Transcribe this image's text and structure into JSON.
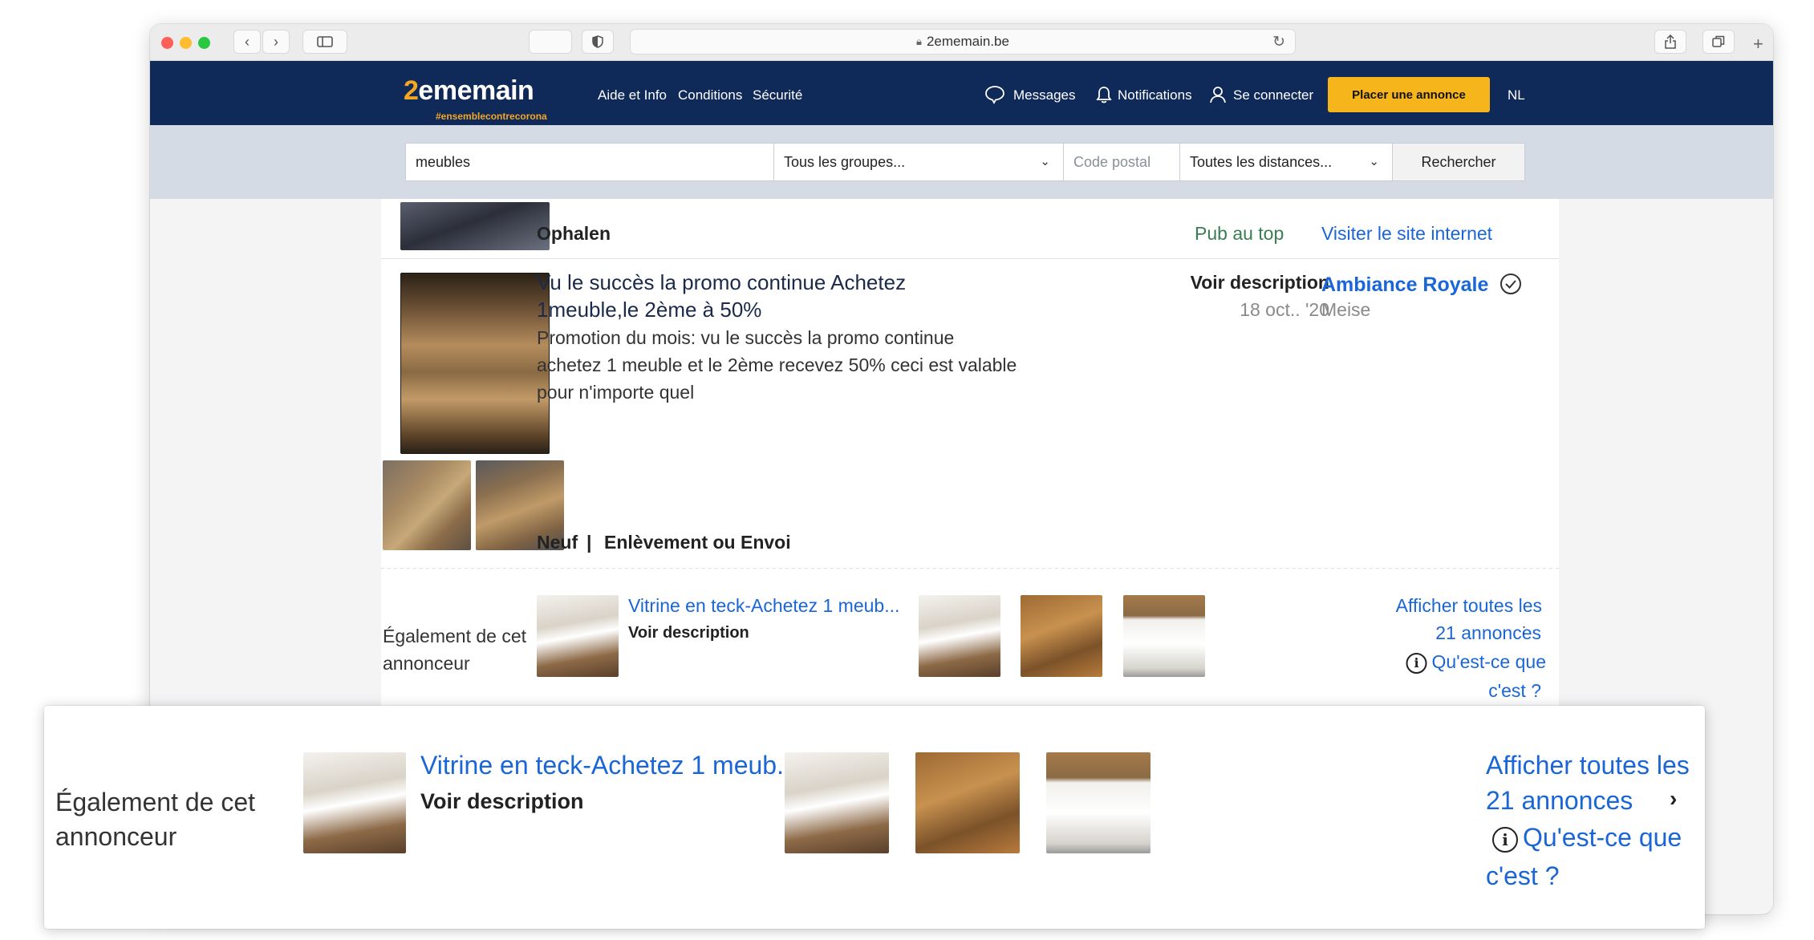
{
  "browser": {
    "url": "2ememain.be"
  },
  "header": {
    "logo": "2ememain",
    "logo_tagline": "#ensemblecontrecorona",
    "nav": [
      "Aide et Info",
      "Conditions",
      "Sécurité"
    ],
    "messages_label": "Messages",
    "notifications_label": "Notifications",
    "login_label": "Se connecter",
    "post_ad_label": "Placer une annonce",
    "language_label": "NL",
    "brand_color": "#0f2a58",
    "accent_color": "#f5b51b"
  },
  "search": {
    "query": "meubles",
    "group_select": "Tous les groupes...",
    "postal_placeholder": "Code postal",
    "distance_select": "Toutes les distances...",
    "submit_label": "Rechercher"
  },
  "prev_listing": {
    "delivery": "Ophalen",
    "top_ad_label": "Pub au top",
    "visit_site_label": "Visiter le site internet"
  },
  "listing": {
    "title_line1": "Vu le succès la promo continue Achetez",
    "title_line2": "1meuble,le 2ème à 50%",
    "desc_line1": "Promotion du mois: vu le succès la promo continue",
    "desc_line2": "achetez 1 meuble et le 2ème recevez 50% ceci est valable",
    "desc_line3": "pour n'importe quel",
    "price": "Voir description",
    "date": "18 oct.. '20",
    "seller": "Ambiance Royale",
    "location": "Meise",
    "condition": "Neuf",
    "separator": "|",
    "delivery": "Enlèvement ou Envoi"
  },
  "also_from": {
    "label_line1": "Également de cet",
    "label_line2": "annonceur",
    "item_title": "Vitrine en teck-Achetez 1 meub...",
    "item_price": "Voir description",
    "show_all_line1": "Afficher toutes les",
    "show_all_line2": "21 annonces",
    "what_line1": "Qu'est-ce que",
    "what_line2": "c'est ?"
  },
  "overlay": {
    "label_line1": "Également de cet",
    "label_line2": "annonceur",
    "item_title": "Vitrine en teck-Achetez 1 meub...",
    "item_price": "Voir description",
    "show_all_line1": "Afficher toutes les",
    "show_all_line2": "21 annonces",
    "what_line1": "Qu'est-ce que",
    "what_line2": "c'est ?"
  }
}
